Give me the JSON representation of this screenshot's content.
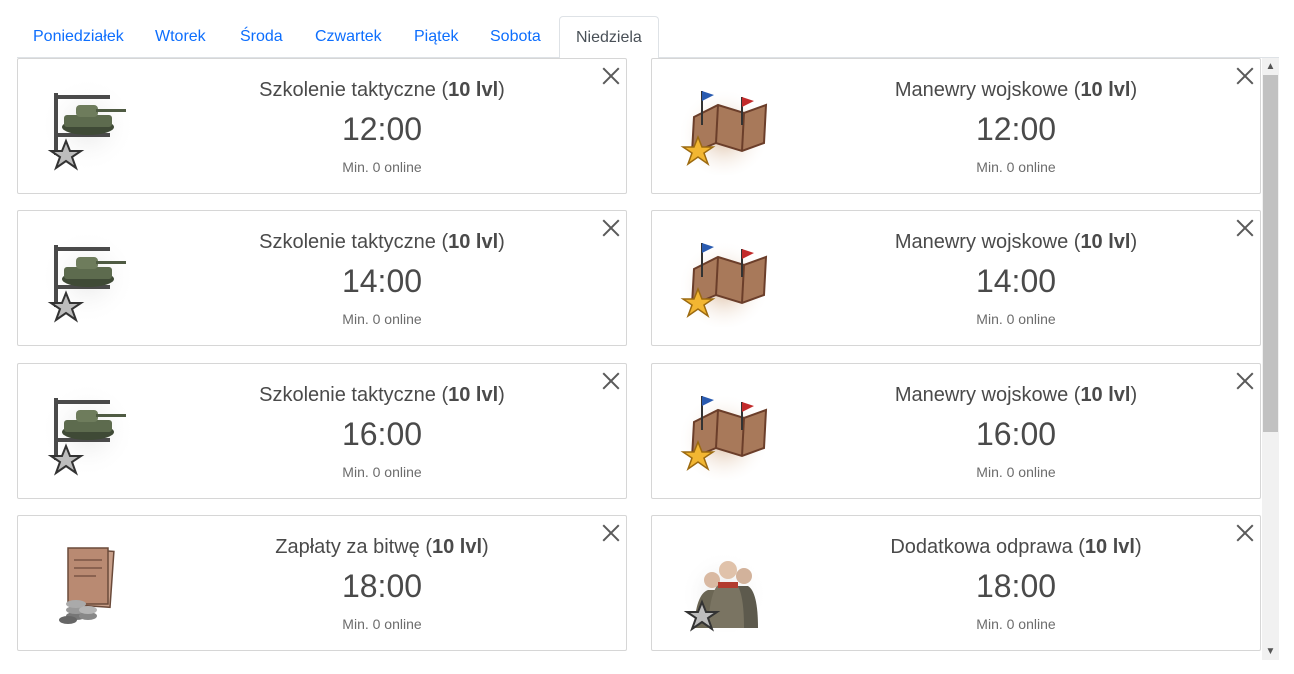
{
  "tabs": [
    {
      "label": "Poniedziałek",
      "active": false
    },
    {
      "label": "Wtorek",
      "active": false
    },
    {
      "label": "Środa",
      "active": false
    },
    {
      "label": "Czwartek",
      "active": false
    },
    {
      "label": "Piątek",
      "active": false
    },
    {
      "label": "Sobota",
      "active": false
    },
    {
      "label": "Niedziela",
      "active": true
    }
  ],
  "cards": [
    {
      "name": "Szkolenie taktyczne",
      "level": "10 lvl",
      "time": "12:00",
      "min": "Min. 0 online",
      "icon": "tank-star-icon"
    },
    {
      "name": "Manewry wojskowe",
      "level": "10 lvl",
      "time": "12:00",
      "min": "Min. 0 online",
      "icon": "map-flags-star-icon"
    },
    {
      "name": "Szkolenie taktyczne",
      "level": "10 lvl",
      "time": "14:00",
      "min": "Min. 0 online",
      "icon": "tank-star-icon"
    },
    {
      "name": "Manewry wojskowe",
      "level": "10 lvl",
      "time": "14:00",
      "min": "Min. 0 online",
      "icon": "map-flags-star-icon"
    },
    {
      "name": "Szkolenie taktyczne",
      "level": "10 lvl",
      "time": "16:00",
      "min": "Min. 0 online",
      "icon": "tank-star-icon"
    },
    {
      "name": "Manewry wojskowe",
      "level": "10 lvl",
      "time": "16:00",
      "min": "Min. 0 online",
      "icon": "map-flags-star-icon"
    },
    {
      "name": "Zapłaty za bitwę",
      "level": "10 lvl",
      "time": "18:00",
      "min": "Min. 0 online",
      "icon": "document-coins-icon"
    },
    {
      "name": "Dodatkowa odprawa",
      "level": "10 lvl",
      "time": "18:00",
      "min": "Min. 0 online",
      "icon": "crew-star-icon"
    }
  ],
  "colors": {
    "tab_link": "#0d6efd",
    "border": "#d6d6d6",
    "text": "#4a4a4a"
  }
}
